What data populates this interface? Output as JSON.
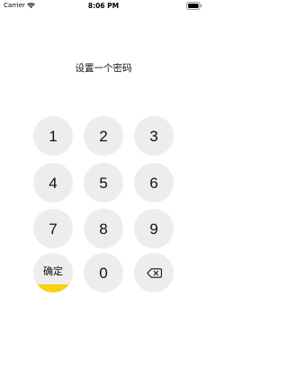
{
  "status_bar": {
    "carrier": "Carrier",
    "time": "8:06 PM",
    "icons": [
      "wifi-icon",
      "battery-icon"
    ]
  },
  "prompt": {
    "title": "设置一个密码"
  },
  "keypad": {
    "keys": [
      "1",
      "2",
      "3",
      "4",
      "5",
      "6",
      "7",
      "8",
      "9"
    ],
    "confirm_label": "确定",
    "zero": "0",
    "delete_icon": "delete-backspace-icon"
  },
  "colors": {
    "key_background": "#ededed",
    "confirm_accent": "#f5d20e",
    "text": "#111111",
    "background": "#ffffff"
  }
}
